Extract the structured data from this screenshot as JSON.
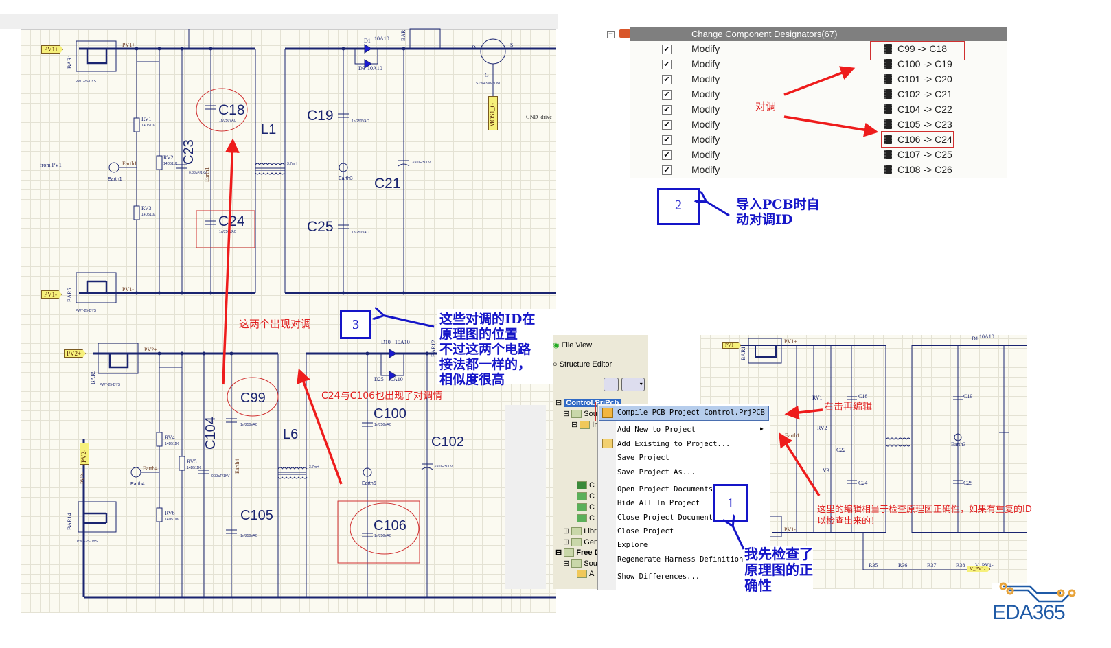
{
  "colors": {
    "wire": "#1a2470",
    "annotation_red": "#e02020",
    "annotation_blue": "#1515c8",
    "header_grey": "#7f7f7f",
    "port_yellow": "#f6f07a",
    "logo_blue": "#1f5aa6",
    "logo_orange": "#e8a33a"
  },
  "schematic_top": {
    "ports": {
      "pv1_plus": "PV1+",
      "pv1_minus": "PV1-",
      "mos1_g": "MOS1_G"
    },
    "nets": {
      "pv1_plus": "PV1+",
      "pv1_minus": "PV1-",
      "earth1": "Earth1",
      "earth1_v": "Earth1",
      "gnd_drive": "GND_drive_"
    },
    "bar1": "BAR1",
    "bar5": "BAR5",
    "bar_top": "BAR",
    "pwt1": "PWT-25-DYS",
    "pwt5": "PWT-25-DYS",
    "from_pv1": "from PV1",
    "rv1": "RV1",
    "rv2": "RV2",
    "rv3": "RV3",
    "varistor_value": "14D511K",
    "earth1_symbol": "Earth1",
    "earth3": "Earth3",
    "c23": "C23",
    "c23_value": "0.33uF/1KV",
    "c18": "C18",
    "c24": "C24",
    "c19": "C19",
    "c25": "C25",
    "c21": "C21",
    "cap_value": "1n/250VAC",
    "c21_value": "330uF/500V",
    "l1": "L1",
    "l1_value": "3.7mH",
    "d1": "D1",
    "d1_value": "10A10",
    "d3": "D3",
    "d3_value": "10A10",
    "mosfet": "STW43NM60ND",
    "mosfet_pin_d": "D",
    "mosfet_pin_s": "S",
    "mosfet_pin_g": "G"
  },
  "schematic_bottom": {
    "ports": {
      "pv2_plus": "PV2+",
      "pv2_minus": "PV2-"
    },
    "nets": {
      "pv2_plus": "PV2+",
      "pv2_minus": "PV2-",
      "earth4": "Earth4",
      "earth4_v": "Earth4"
    },
    "bar9": "BAR9",
    "bar14": "BAR14",
    "bar12": "BAR12",
    "pwt9": "PWT-25-DYS",
    "pwt14": "PWT-25-DYS",
    "rv4": "RV4",
    "rv5": "RV5",
    "rv6": "RV6",
    "varistor_value": "14D511K",
    "earth4_symbol": "Earth4",
    "earth6": "Earth6",
    "c104": "C104",
    "c104_value": "0.33uF/1KV",
    "c99": "C99",
    "c105": "C105",
    "c100": "C100",
    "c106": "C106",
    "c102": "C102",
    "cap_value": "1n/250VAC",
    "c102_value": "330uF/500V",
    "l6": "L6",
    "l6_value": "3.7mH",
    "d10": "D10",
    "d10_value": "10A10",
    "d25": "D25",
    "d25_value": "10A10"
  },
  "annotations": {
    "swap_pair": "这两个出现对调",
    "c24_c106": "C24与C106也出现了对调情",
    "step3_number": "3",
    "step3_text": [
      "这些对调的ID在",
      "原理图的位置",
      "不过这两个电路",
      "接法都一样的，",
      "相似度很高"
    ],
    "swap": "对调",
    "step2_number": "2",
    "step2_text": [
      "导入PCB时自",
      "动对调ID"
    ],
    "right_click": "右击再编辑",
    "compile_note": [
      "这里的编辑相当于检查原理图正确性，如果有重复的ID",
      "以检查出来的！"
    ],
    "step1_number": "1",
    "step1_text": [
      "我先检查了",
      "原理图的正",
      "确性"
    ]
  },
  "eco_list": {
    "header": "Change Component Designators(67)",
    "rows": [
      {
        "checked": true,
        "action": "Modify",
        "change": "C99 -> C18"
      },
      {
        "checked": true,
        "action": "Modify",
        "change": "C100 -> C19"
      },
      {
        "checked": true,
        "action": "Modify",
        "change": "C101 -> C20"
      },
      {
        "checked": true,
        "action": "Modify",
        "change": "C102 -> C21"
      },
      {
        "checked": true,
        "action": "Modify",
        "change": "C104 -> C22"
      },
      {
        "checked": true,
        "action": "Modify",
        "change": "C105 -> C23"
      },
      {
        "checked": true,
        "action": "Modify",
        "change": "C106 -> C24"
      },
      {
        "checked": true,
        "action": "Modify",
        "change": "C107 -> C25"
      },
      {
        "checked": true,
        "action": "Modify",
        "change": "C108 -> C26"
      }
    ]
  },
  "projects_panel": {
    "file_view": "File View",
    "structure_editor": "Structure Editor",
    "file_view_selected": true,
    "tree": [
      "Control.PrjPcb",
      "Sou",
      "In",
      "C",
      "C",
      "C",
      "C",
      "Libra",
      "Gen",
      "Free D",
      "Sou",
      "A"
    ]
  },
  "context_menu": {
    "items": [
      "Compile PCB Project Control.PrjPCB",
      "Add New to Project",
      "Add Existing to Project...",
      "Save Project",
      "Save Project As...",
      "Open Project Documents",
      "Hide All In Project",
      "Close Project Documents",
      "Close Project",
      "Explore",
      "Regenerate Harness Definitions",
      "Show Differences..."
    ],
    "highlighted": "Compile PCB Project Control.PrjPCB"
  },
  "schematic_right": {
    "pv1_plus_port": "PV1+",
    "pv1_plus": "PV1+",
    "pv1_minus": "PV1-",
    "bar1": "BAR1",
    "rv1": "RV1",
    "rv2": "RV2",
    "rv3": "V3",
    "c18": "C18",
    "c19": "C19",
    "c24": "C24",
    "c25": "C25",
    "c22": "C22",
    "earth1": "Earth1",
    "earth3": "Earth3",
    "d1": "D1",
    "d1_value": "10A10",
    "r35": "R35",
    "r36": "R36",
    "r37": "R37",
    "r38": "R38",
    "v_pv1": "V_PV1-",
    "v_pv1_port": "V_PV1-"
  },
  "logo": {
    "text": "EDA365"
  }
}
